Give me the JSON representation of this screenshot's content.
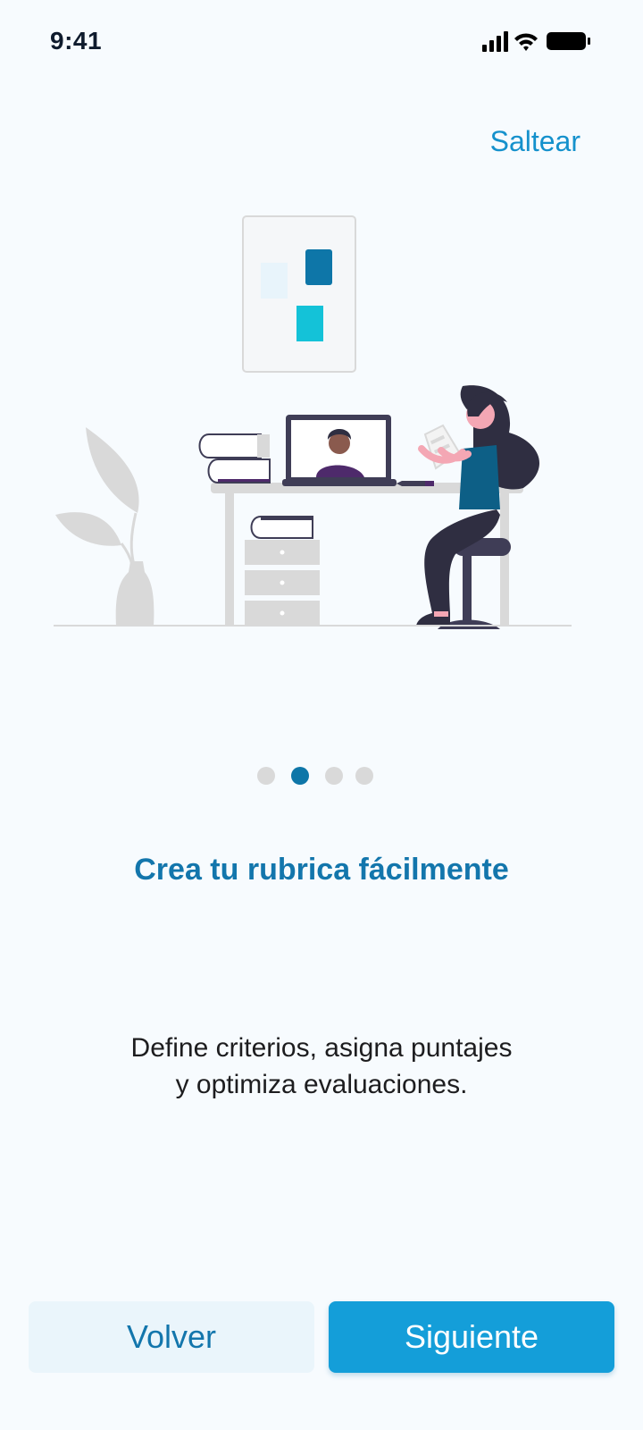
{
  "status_bar": {
    "time": "9:41",
    "icons": [
      "signal-icon",
      "wifi-icon",
      "battery-icon"
    ]
  },
  "onboarding": {
    "skip_label": "Saltear",
    "illustration": "person-at-desk-video-call-illustration",
    "pager": {
      "total": 4,
      "active_index": 1
    },
    "title": "Crea tu rubrica fácilmente",
    "description_line1": "Define criterios, asigna puntajes",
    "description_line2": "y optimiza evaluaciones."
  },
  "actions": {
    "back_label": "Volver",
    "next_label": "Siguiente"
  },
  "colors": {
    "accent": "#149ed9",
    "title": "#1376ac",
    "background": "#f7fbfe",
    "pager_active": "#0e76a8",
    "pager_inactive": "#d9d9d9"
  }
}
